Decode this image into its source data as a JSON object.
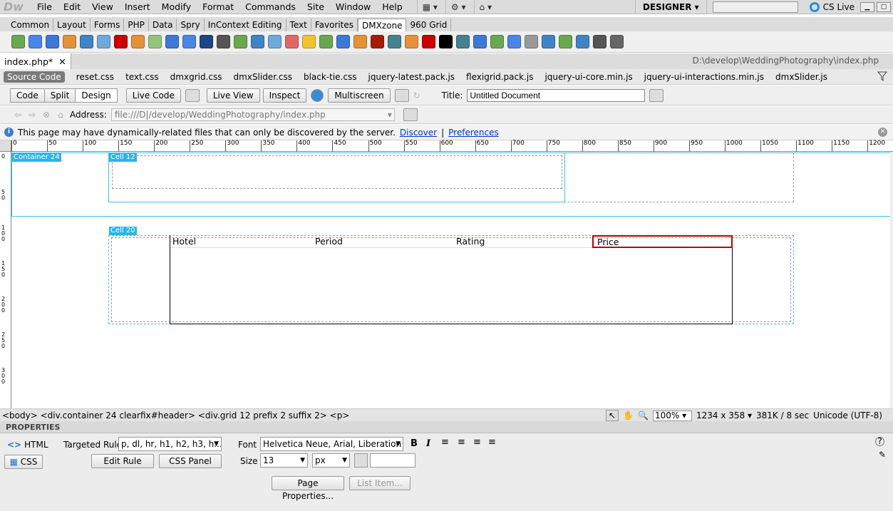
{
  "app": {
    "logo": "Dw",
    "workspace": "DESIGNER",
    "cs_live": "CS Live"
  },
  "menu": [
    "File",
    "Edit",
    "View",
    "Insert",
    "Modify",
    "Format",
    "Commands",
    "Site",
    "Window",
    "Help"
  ],
  "insert_tabs": [
    "Common",
    "Layout",
    "Forms",
    "PHP",
    "Data",
    "Spry",
    "InContext Editing",
    "Text",
    "Favorites",
    "DMXzone",
    "960 Grid"
  ],
  "insert_active": "DMXzone",
  "doc": {
    "tab": "index.php*",
    "path": "D:\\develop\\WeddingPhotography\\index.php"
  },
  "related": {
    "source": "Source Code",
    "files": [
      "reset.css",
      "text.css",
      "dmxgrid.css",
      "dmxSlider.css",
      "black-tie.css",
      "jquery-latest.pack.js",
      "flexigrid.pack.js",
      "jquery-ui-core.min.js",
      "jquery-ui-interactions.min.js",
      "dmxSlider.js"
    ]
  },
  "toolbar": {
    "code": "Code",
    "split": "Split",
    "design": "Design",
    "live_code": "Live Code",
    "live_view": "Live View",
    "inspect": "Inspect",
    "multiscreen": "Multiscreen",
    "title_label": "Title:",
    "title_value": "Untitled Document"
  },
  "address": {
    "label": "Address:",
    "value": "file:///D|/develop/WeddingPhotography/index.php"
  },
  "info": {
    "text": "This page may have dynamically-related files that can only be discovered by the server.",
    "discover": "Discover",
    "sep": "|",
    "preferences": "Preferences"
  },
  "ruler": [
    "0",
    "50",
    "100",
    "150",
    "200",
    "250",
    "300",
    "350",
    "400",
    "450",
    "500",
    "550",
    "600",
    "650",
    "700",
    "750",
    "800",
    "850",
    "900",
    "950",
    "1000",
    "1050",
    "1100",
    "1150",
    "1200"
  ],
  "vruler": [
    "0",
    "50",
    "100",
    "150",
    "200",
    "250",
    "300"
  ],
  "design": {
    "container_label": "Container 24",
    "cell12_label": "Cell 12",
    "cell20_label": "Cell 20",
    "columns": [
      "Hotel",
      "Period",
      "Rating",
      "Price"
    ]
  },
  "status": {
    "path": "<body> <div.container  24 clearfix#header> <div.grid  12 prefix  2 suffix  2> <p>",
    "zoom": "100%",
    "size": "1234 x 358",
    "weight": "381K / 8 sec",
    "encoding": "Unicode (UTF-8)"
  },
  "props": {
    "title": "PROPERTIES",
    "html": "HTML",
    "css": "CSS",
    "targeted_rule_label": "Targeted Rule",
    "targeted_rule": "p, dl, hr, h1, h2, h3, h...",
    "edit_rule": "Edit Rule",
    "css_panel": "CSS Panel",
    "font_label": "Font",
    "font_value": "Helvetica Neue, Arial, Liberation Sans",
    "size_label": "Size",
    "size_value": "13",
    "unit": "px",
    "page_props": "Page Properties...",
    "list_item": "List Item..."
  },
  "colors": {
    "accent": "#2bb5e8",
    "selected_cell": "#c00000"
  }
}
